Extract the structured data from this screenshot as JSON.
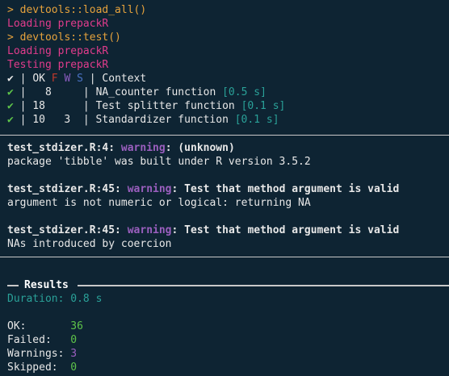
{
  "console": {
    "prompt": ">",
    "cmd_load": "devtools::load_all()",
    "msg_loading_1": "Loading prepackR",
    "cmd_test": "devtools::test()",
    "msg_loading_2": "Loading prepackR",
    "msg_testing": "Testing prepackR"
  },
  "table": {
    "header": {
      "check": "✔",
      "sep": "|",
      "ok": "OK",
      "f": "F",
      "w": "W",
      "s": "S",
      "context": "Context"
    },
    "rows": [
      {
        "check": "✔",
        "ok": "8",
        "w": "",
        "context": "NA_counter function",
        "time": "[0.5 s]"
      },
      {
        "check": "✔",
        "ok": "18",
        "w": "",
        "context": "Test splitter function",
        "time": "[0.1 s]"
      },
      {
        "check": "✔",
        "ok": "10",
        "w": "3",
        "context": "Standardizer function",
        "time": "[0.1 s]"
      }
    ]
  },
  "warnings": [
    {
      "location": "test_stdizer.R:4:",
      "label": "warning",
      "title": "(unknown)",
      "message": "package 'tibble' was built under R version 3.5.2"
    },
    {
      "location": "test_stdizer.R:45:",
      "label": "warning",
      "title": "Test that method argument is valid",
      "message": "argument is not numeric or logical: returning NA"
    },
    {
      "location": "test_stdizer.R:45:",
      "label": "warning",
      "title": "Test that method argument is valid",
      "message": "NAs introduced by coercion"
    }
  ],
  "results": {
    "title": "Results",
    "duration": "Duration: 0.8 s",
    "ok_label": "OK:",
    "ok_value": "36",
    "failed_label": "Failed:",
    "failed_value": "0",
    "warnings_label": "Warnings:",
    "warnings_value": "3",
    "skipped_label": "Skipped:",
    "skipped_value": "0"
  },
  "colors": {
    "background": "#0e2433",
    "prompt": "#e6a23c",
    "loading": "#e13c8c",
    "check": "#5ec44a",
    "timing": "#2aa198",
    "warning": "#9b5fbf"
  }
}
